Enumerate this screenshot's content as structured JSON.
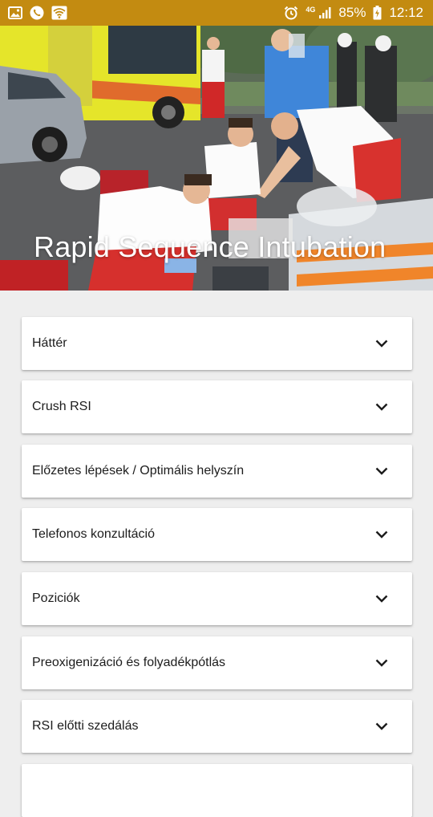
{
  "status_bar": {
    "left_icons": [
      "image-icon",
      "phone-icon",
      "wifi-icon"
    ],
    "right_icons": [
      "alarm-icon",
      "signal-4g-icon",
      "battery-icon"
    ],
    "network": "4G",
    "battery": "85%",
    "time": "12:12",
    "color": "#c38b11"
  },
  "hero": {
    "title": "Rapid Sequence Intubation"
  },
  "sections": [
    {
      "label": "Háttér"
    },
    {
      "label": "Crush RSI"
    },
    {
      "label": "Előzetes lépések / Optimális helyszín"
    },
    {
      "label": "Telefonos konzultáció"
    },
    {
      "label": "Poziciók"
    },
    {
      "label": "Preoxigenizáció és folyadékpótlás"
    },
    {
      "label": "RSI előtti szedálás"
    },
    {
      "label": ""
    }
  ]
}
